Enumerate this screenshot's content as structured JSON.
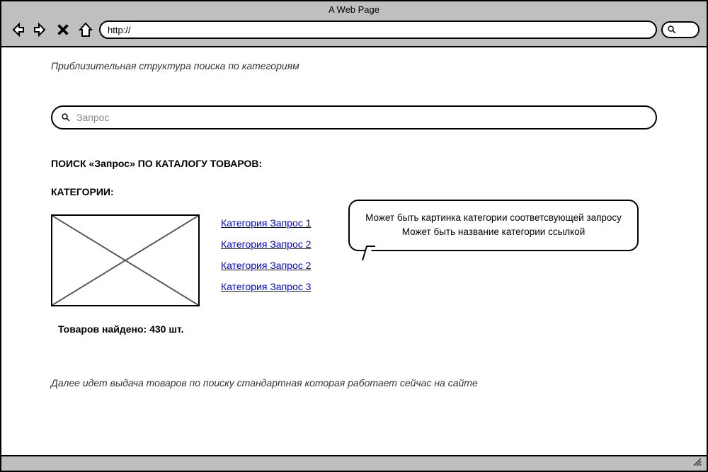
{
  "window": {
    "title": "A Web Page",
    "url_value": "http://"
  },
  "content": {
    "description": "Приблизительная структура поиска по категориям",
    "search_placeholder": "Запрос",
    "search_heading": "ПОИСК «Запрос» ПО КАТАЛОГУ ТОВАРОВ:",
    "categories_heading": "КАТЕГОРИИ:",
    "category_links": [
      "Категория Запрос 1",
      "Категория Запрос 2",
      "Категория Запрос 2",
      "Категория Запрос 3"
    ],
    "found_text": "Товаров найдено: 430 шт.",
    "bubble_line1": "Может быть картинка категории соответсвующей запросу",
    "bubble_line2": "Может быть название категории ссылкой",
    "footer_note": "Далее идет выдача товаров по поиску стандартная которая работает сейчас на сайте"
  }
}
